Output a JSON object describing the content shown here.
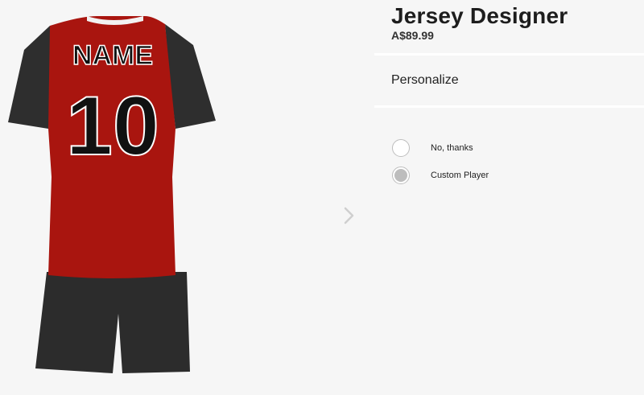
{
  "product": {
    "title": "Jersey Designer",
    "price": "A$89.99"
  },
  "personalize": {
    "section_label": "Personalize",
    "options": [
      {
        "label": "No, thanks",
        "selected": false
      },
      {
        "label": "Custom Player",
        "selected": true
      }
    ]
  },
  "jersey": {
    "name_print": "NAME",
    "number_print": "10",
    "colors": {
      "body": "#a9150f",
      "sleeves": "#2e2e2e",
      "shorts": "#2c2c2c",
      "collar": "#f2f2f2"
    }
  },
  "nav": {
    "next_icon": "chevron-right-icon"
  }
}
